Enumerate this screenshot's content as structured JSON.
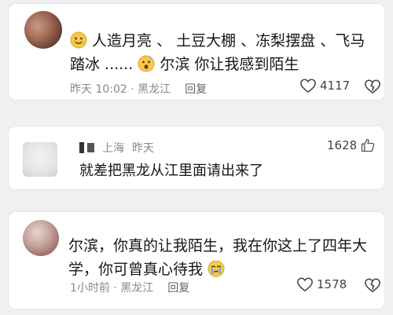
{
  "comments": [
    {
      "text_part1": "人造月亮 、 土豆大棚 、冻梨摆盘 、飞马踏冰 ......",
      "text_part2": "尔滨 你让我感到陌生",
      "time_location": "昨天 10:02 · 黑龙江",
      "reply_label": "回复",
      "likes": "4117"
    },
    {
      "location": "上海",
      "time": "昨天",
      "likes": "1628",
      "text": "就差把黑龙从江里面请出来了"
    },
    {
      "text": "尔滨，你真的让我陌生，我在你这上了四年大学，你可曾真心待我",
      "time_location": "1小时前 · 黑龙江",
      "reply_label": "回复",
      "likes": "1578"
    }
  ]
}
